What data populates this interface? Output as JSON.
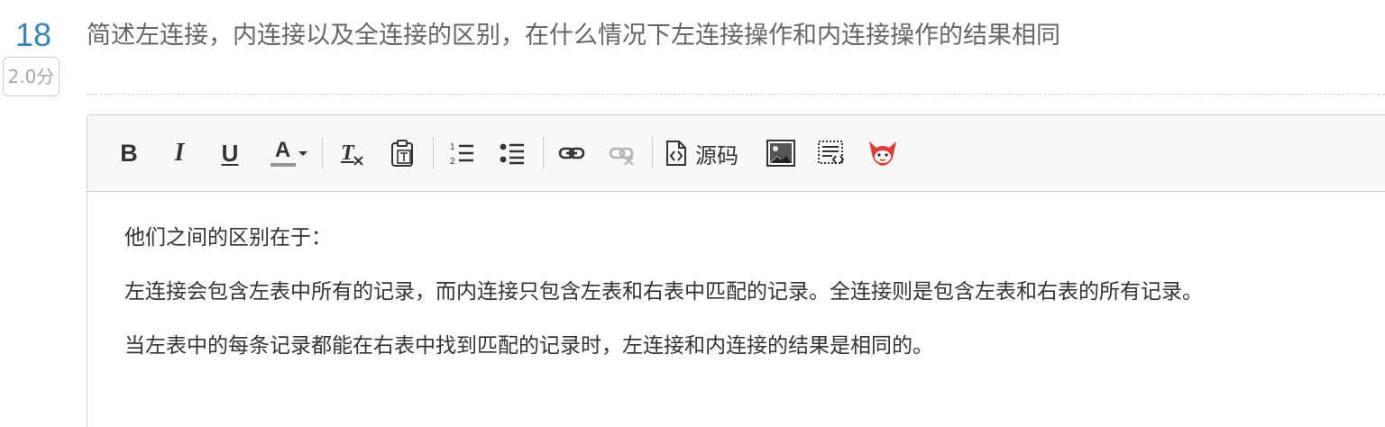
{
  "question": {
    "number": "18",
    "score": "2.0分",
    "title": "简述左连接，内连接以及全连接的区别，在什么情况下左连接操作和内连接操作的结果相同"
  },
  "toolbar": {
    "bold_label": "B",
    "italic_label": "I",
    "underline_label": "U",
    "font_color_label": "A",
    "source_label": "源码",
    "buttons": [
      "bold-icon",
      "italic-icon",
      "underline-icon",
      "font-color-icon",
      "remove-format-icon",
      "paste-text-icon",
      "ordered-list-icon",
      "unordered-list-icon",
      "link-icon",
      "unlink-icon",
      "source-code-icon",
      "image-icon",
      "template-icon",
      "plugin-icon"
    ],
    "accent_color": "#e53935",
    "font_color_bar": "#999999"
  },
  "answer": {
    "paragraphs": [
      "他们之间的区别在于：",
      "左连接会包含左表中所有的记录，而内连接只包含左表和右表中匹配的记录。全连接则是包含左表和右表的所有记录。",
      "当左表中的每条记录都能在右表中找到匹配的记录时，左连接和内连接的结果是相同的。"
    ]
  },
  "colors": {
    "number": "#3a85b8",
    "score_text": "#a9a9a9",
    "title_text": "#666666",
    "body_text": "#333333",
    "toolbar_bg": "#f8f8f8"
  }
}
